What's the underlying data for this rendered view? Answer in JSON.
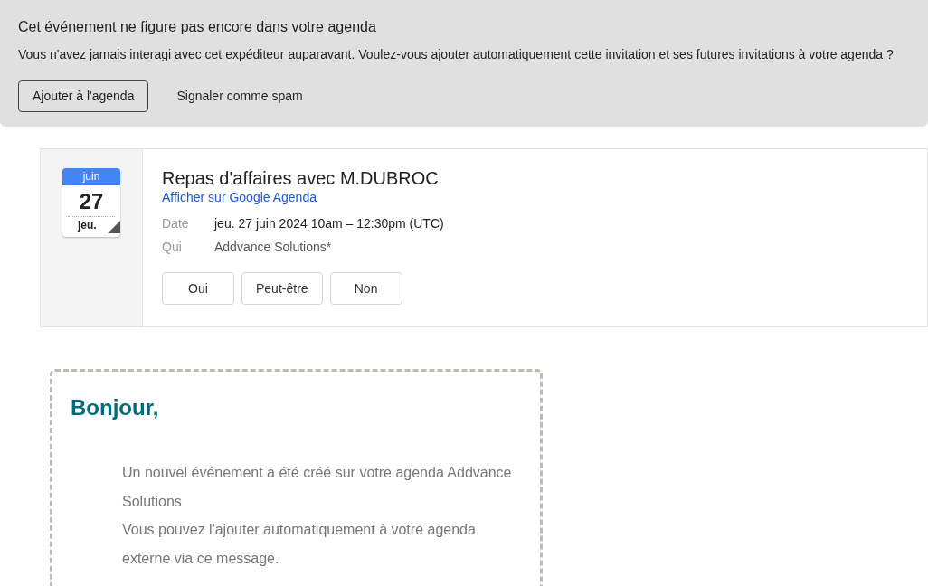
{
  "banner": {
    "title": "Cet événement ne figure pas encore dans votre agenda",
    "message": "Vous n'avez jamais interagi avec cet expéditeur auparavant. Voulez-vous ajouter automatiquement cette invitation et ses futures invitations à votre agenda ?",
    "actions": [
      {
        "label": "Ajouter à l'agenda",
        "kind": "outlined"
      },
      {
        "label": "Signaler comme spam",
        "kind": "text"
      }
    ]
  },
  "invite": {
    "calendar": {
      "month": "juin",
      "day": "27",
      "weekday": "jeu."
    },
    "title": "Repas d'affaires avec M.DUBROC",
    "link": "Afficher sur Google Agenda",
    "details": [
      {
        "label": "Date",
        "value": "jeu. 27 juin 2024 10am – 12:30pm (UTC)",
        "kind": "dark"
      },
      {
        "label": "Qui",
        "value": "Addvance Solutions*",
        "kind": "muted"
      }
    ],
    "rsvp": [
      "Oui",
      "Peut-être",
      "Non"
    ]
  },
  "email": {
    "greeting": "Bonjour,",
    "paragraphs": [
      "Un nouvel événement a été créé sur votre agenda Addvance Solutions",
      "Vous pouvez l'ajouter automatiquement à votre agenda externe via ce message."
    ]
  }
}
